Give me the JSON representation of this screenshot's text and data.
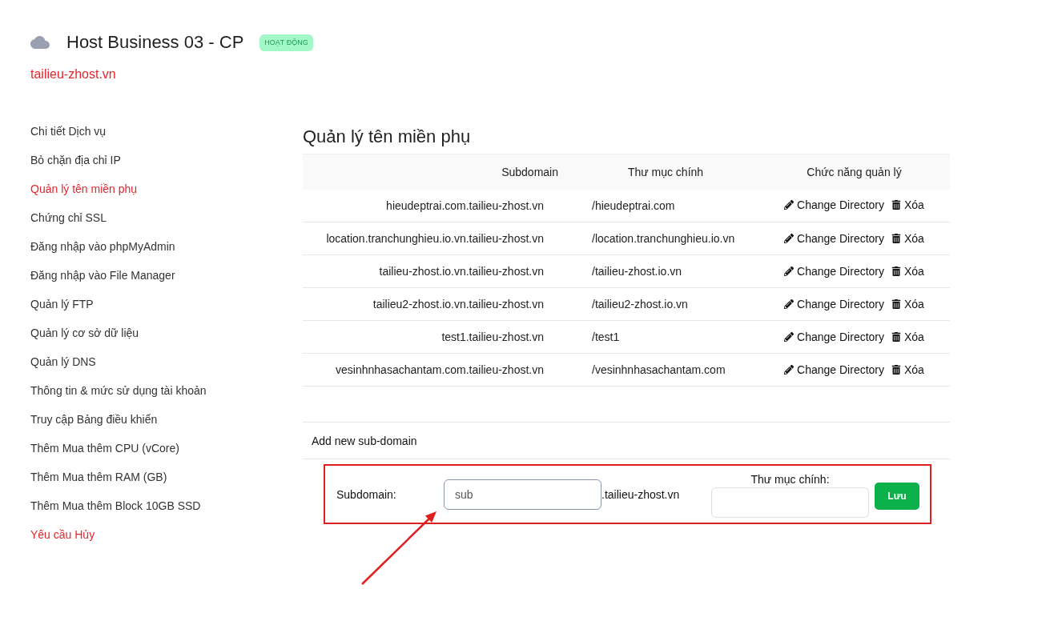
{
  "header": {
    "title": "Host Business 03 - CP",
    "status_badge": "HOẠT ĐỘNG",
    "domain_link": "tailieu-zhost.vn"
  },
  "sidebar": {
    "items": [
      {
        "label": "Chi tiết Dịch vụ",
        "color": "#333333"
      },
      {
        "label": "Bỏ chặn địa chỉ IP",
        "color": "#333333"
      },
      {
        "label": "Quản lý tên miền phụ",
        "color": "#e3262c"
      },
      {
        "label": "Chứng chỉ SSL",
        "color": "#333333"
      },
      {
        "label": "Đăng nhập vào phpMyAdmin",
        "color": "#333333"
      },
      {
        "label": "Đăng nhập vào File Manager",
        "color": "#333333"
      },
      {
        "label": "Quản lý FTP",
        "color": "#333333"
      },
      {
        "label": "Quản lý cơ sở dữ liệu",
        "color": "#333333"
      },
      {
        "label": "Quản lý DNS",
        "color": "#333333"
      },
      {
        "label": "Thông tin & mức sử dụng tài khoản",
        "color": "#333333"
      },
      {
        "label": "Truy cập Bảng điều khiển",
        "color": "#333333"
      },
      {
        "label": "Thêm Mua thêm CPU (vCore)",
        "color": "#333333"
      },
      {
        "label": "Thêm Mua thêm RAM (GB)",
        "color": "#333333"
      },
      {
        "label": "Thêm Mua thêm Block 10GB SSD",
        "color": "#333333"
      },
      {
        "label": "Yêu cầu Hủy",
        "color": "#e3262c"
      }
    ]
  },
  "subdomains": {
    "title": "Quản lý tên miền phụ",
    "columns": [
      "Subdomain",
      "Thư mục chính",
      "Chức năng quản lý"
    ],
    "rows": [
      {
        "subdomain": "hieudeptrai.com.tailieu-zhost.vn",
        "directory": "/hieudeptrai.com",
        "actions": [
          {
            "kind": "edit",
            "label": "Change Directory"
          },
          {
            "kind": "delete",
            "label": "Xóa"
          }
        ]
      },
      {
        "subdomain": "location.tranchunghieu.io.vn.tailieu-zhost.vn",
        "directory": "/location.tranchunghieu.io.vn",
        "actions": [
          {
            "kind": "edit",
            "label": "Change Directory"
          },
          {
            "kind": "delete",
            "label": "Xóa"
          }
        ]
      },
      {
        "subdomain": "tailieu-zhost.io.vn.tailieu-zhost.vn",
        "directory": "/tailieu-zhost.io.vn",
        "actions": [
          {
            "kind": "edit",
            "label": "Change Directory"
          },
          {
            "kind": "delete",
            "label": "Xóa"
          }
        ]
      },
      {
        "subdomain": "tailieu2-zhost.io.vn.tailieu-zhost.vn",
        "directory": "/tailieu2-zhost.io.vn",
        "actions": [
          {
            "kind": "edit",
            "label": "Change Directory"
          },
          {
            "kind": "delete",
            "label": "Xóa"
          }
        ]
      },
      {
        "subdomain": "test1.tailieu-zhost.vn",
        "directory": "/test1",
        "actions": [
          {
            "kind": "edit",
            "label": "Change Directory"
          },
          {
            "kind": "delete",
            "label": "Xóa"
          }
        ]
      },
      {
        "subdomain": "vesinhnhasachantam.com.tailieu-zhost.vn",
        "directory": "/vesinhnhasachantam.com",
        "actions": [
          {
            "kind": "edit",
            "label": "Change Directory"
          },
          {
            "kind": "delete",
            "label": "Xóa"
          }
        ]
      }
    ]
  },
  "add_form": {
    "title": "Add new sub-domain",
    "highlighted": true,
    "subdomain_label": "Subdomain:",
    "subdomain_value": "sub",
    "domain_suffix": ".tailieu-zhost.vn",
    "directory_label": "Thư mục chính:",
    "save_button": "Lưu"
  }
}
